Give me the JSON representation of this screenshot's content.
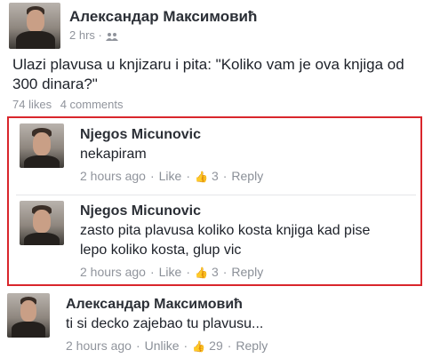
{
  "post": {
    "author": "Александар Максимовић",
    "time": "2 hrs",
    "privacy_icon": "friends-icon",
    "text": "Ulazi plavusa u knjizaru i pita: \"Koliko vam je ova knjiga od 300 dinara?\"",
    "likes": "74 likes",
    "comments": "4 comments"
  },
  "comments": [
    {
      "author": "Njegos Micunovic",
      "text": "nekapiram",
      "time": "2 hours ago",
      "action": "Like",
      "likes": "3",
      "reply": "Reply"
    },
    {
      "author": "Njegos Micunovic",
      "text": "zasto pita plavusa koliko kosta knjiga kad pise lepo koliko kosta, glup vic",
      "time": "2 hours ago",
      "action": "Like",
      "likes": "3",
      "reply": "Reply"
    },
    {
      "author": "Александар Максимовић",
      "text": "ti si decko zajebao tu plavusu...",
      "time": "2 hours ago",
      "action": "Unlike",
      "likes": "29",
      "reply": "Reply"
    }
  ],
  "colors": {
    "highlight": "#d9262c",
    "meta": "#90949c",
    "thumb": "#5b7bc0"
  }
}
